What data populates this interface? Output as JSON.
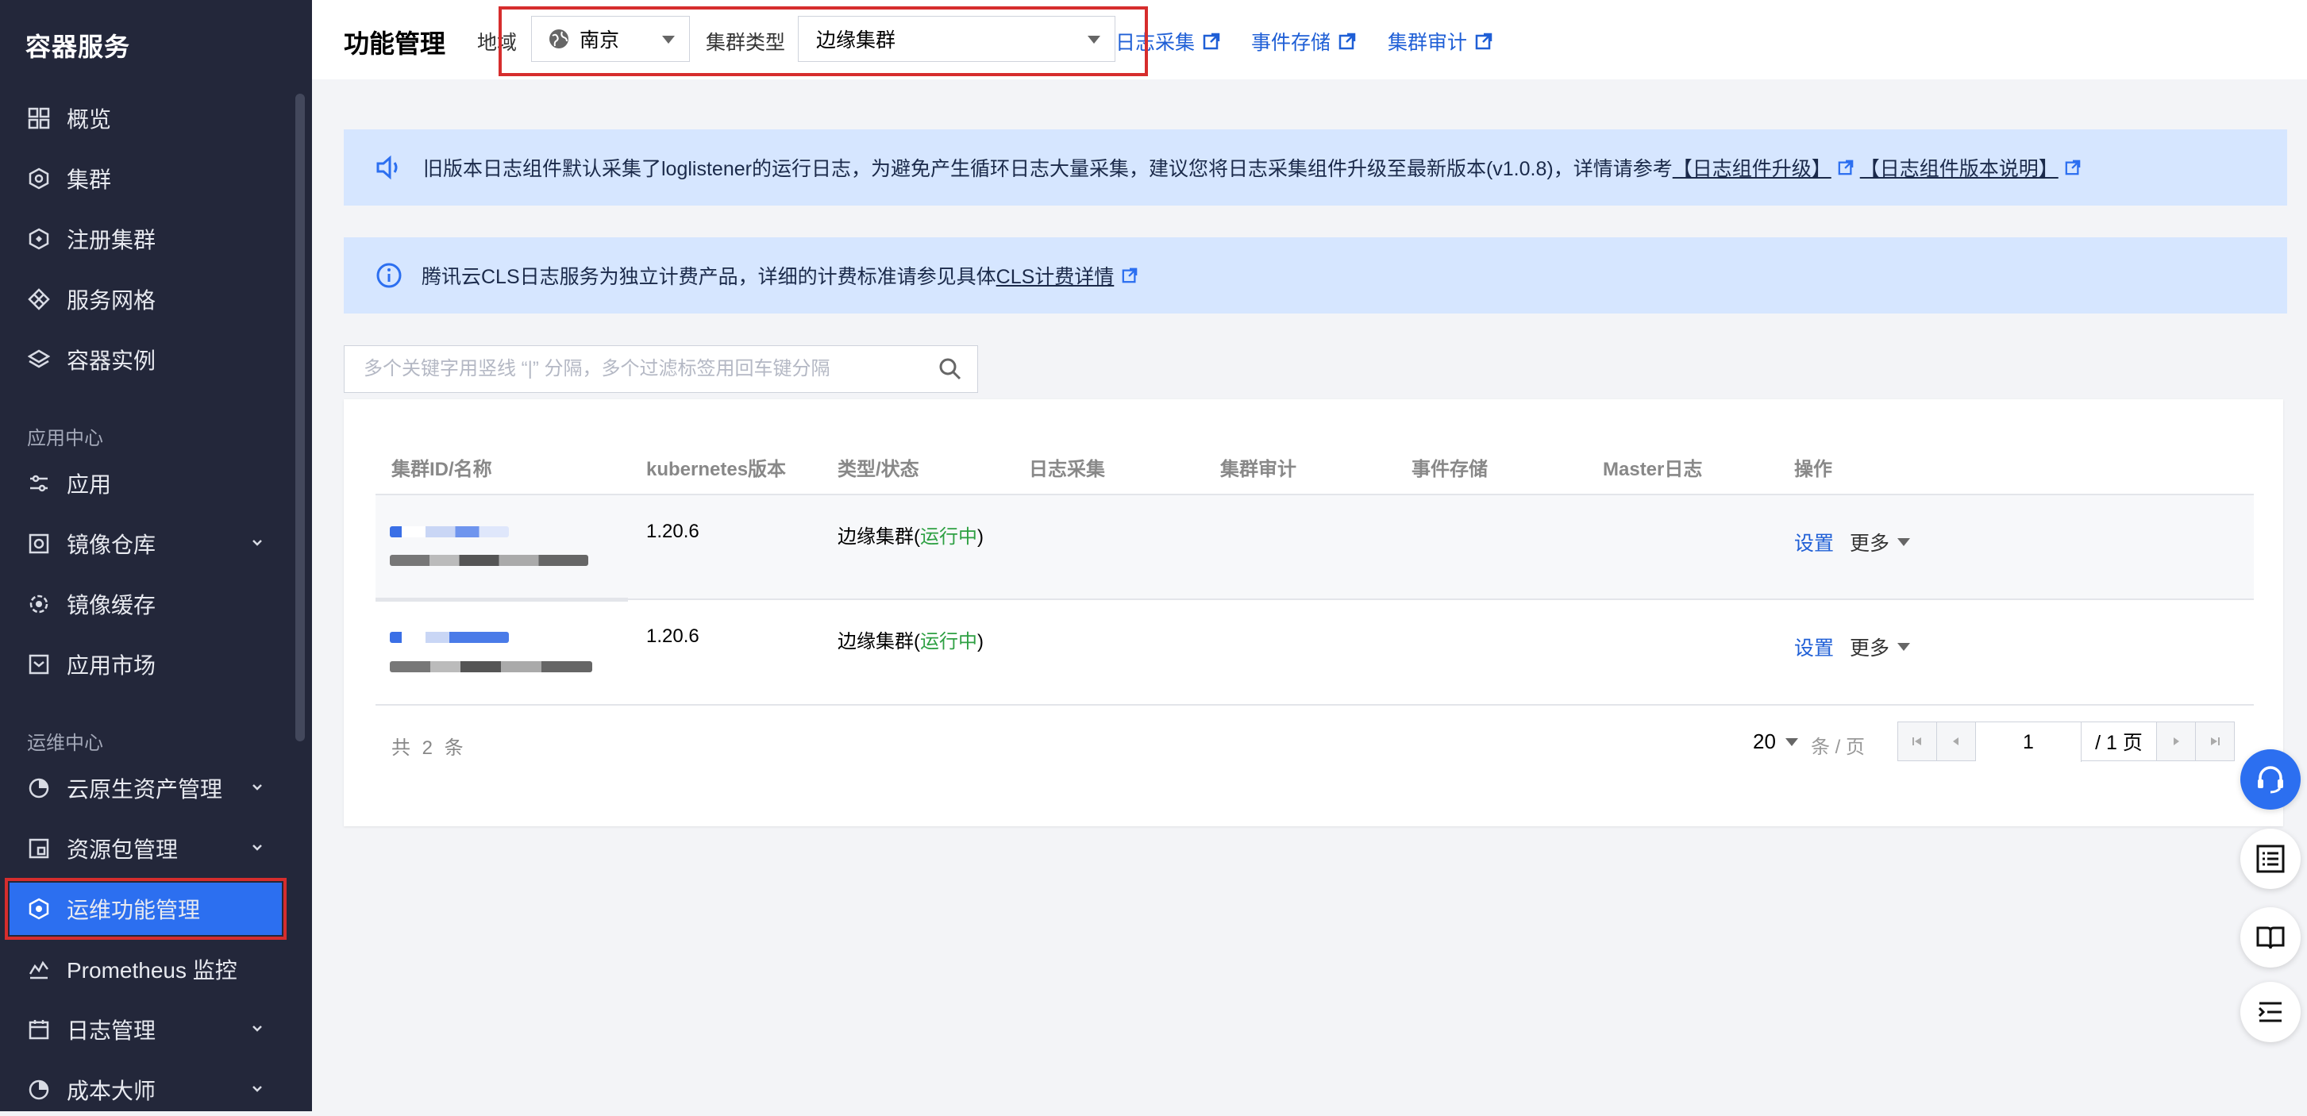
{
  "sidebar": {
    "brand": "容器服务",
    "items": [
      {
        "label": "概览",
        "icon": "grid-icon"
      },
      {
        "label": "集群",
        "icon": "cluster-icon"
      },
      {
        "label": "注册集群",
        "icon": "register-cluster-icon"
      },
      {
        "label": "服务网格",
        "icon": "mesh-icon"
      },
      {
        "label": "容器实例",
        "icon": "layers-icon"
      }
    ],
    "section_app": "应用中心",
    "app_items": [
      {
        "label": "应用",
        "icon": "app-icon"
      },
      {
        "label": "镜像仓库",
        "icon": "registry-icon"
      },
      {
        "label": "镜像缓存",
        "icon": "cache-icon"
      },
      {
        "label": "应用市场",
        "icon": "market-icon"
      }
    ],
    "section_ops": "运维中心",
    "ops_items": [
      {
        "label": "云原生资产管理",
        "icon": "pie-icon"
      },
      {
        "label": "资源包管理",
        "icon": "package-icon"
      },
      {
        "label": "运维功能管理",
        "icon": "ops-icon"
      },
      {
        "label": "Prometheus 监控",
        "icon": "monitor-icon"
      },
      {
        "label": "日志管理",
        "icon": "calendar-icon"
      },
      {
        "label": "成本大师",
        "icon": "cost-icon"
      }
    ]
  },
  "header": {
    "title": "功能管理",
    "region_label": "地域",
    "region_value": "南京",
    "cluster_type_label": "集群类型",
    "cluster_type_value": "边缘集群",
    "links": [
      "日志采集",
      "事件存储",
      "集群审计"
    ]
  },
  "notices": {
    "n1_text": "旧版本日志组件默认采集了loglistener的运行日志，为避免产生循环日志大量采集，建议您将日志采集组件升级至最新版本(v1.0.8)，详情请参考",
    "n1_link1": "【日志组件升级】",
    "n1_link2": "【日志组件版本说明】",
    "n2_text": "腾讯云CLS日志服务为独立计费产品，详细的计费标准请参见具体",
    "n2_link": "CLS计费详情"
  },
  "search": {
    "placeholder": "多个关键字用竖线 “|” 分隔，多个过滤标签用回车键分隔"
  },
  "table": {
    "headers": [
      "集群ID/名称",
      "kubernetes版本",
      "类型/状态",
      "日志采集",
      "集群审计",
      "事件存储",
      "Master日志",
      "操作"
    ],
    "rows": [
      {
        "version": "1.20.6",
        "type": "边缘集群",
        "status": "运行中",
        "op_set": "设置",
        "op_more": "更多"
      },
      {
        "version": "1.20.6",
        "type": "边缘集群",
        "status": "运行中",
        "op_set": "设置",
        "op_more": "更多"
      }
    ],
    "paren_open": "(",
    "paren_close": ")"
  },
  "pagination": {
    "total": "共 2 条",
    "page_size": "20",
    "per_page": "条 / 页",
    "current": "1",
    "pages": "/ 1 页"
  },
  "colors": {
    "sidebar_bg": "#23273a",
    "accent": "#2c6ff0",
    "highlight": "#d62d2d",
    "running": "#2ea043",
    "notice_bg": "#d6e6ff"
  }
}
